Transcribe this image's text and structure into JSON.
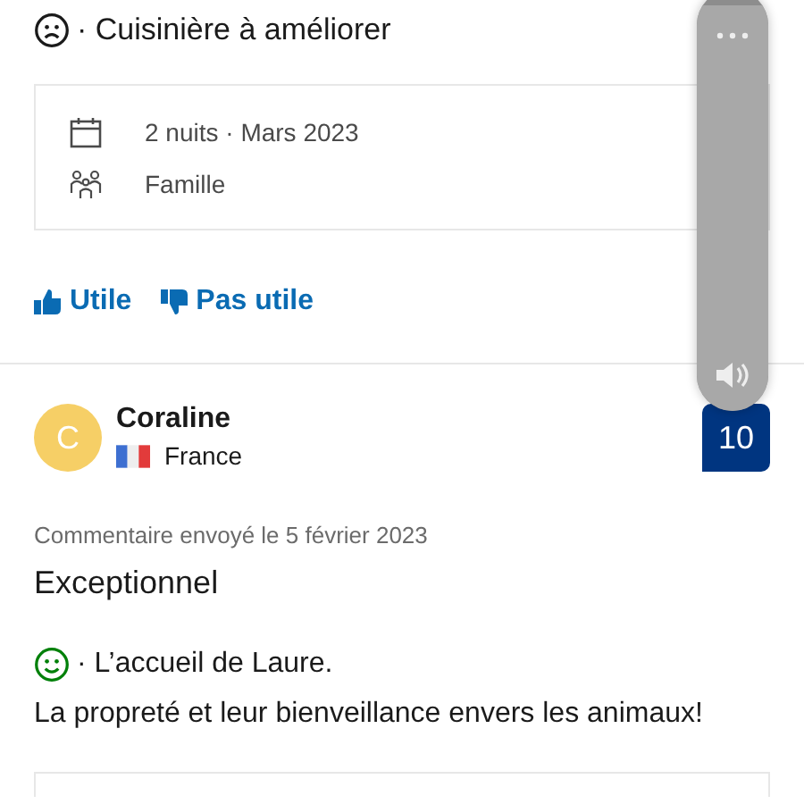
{
  "previous_review": {
    "negative": "· Cuisinière à améliorer",
    "stay": "2 nuits · Mars 2023",
    "traveler_type": "Famille",
    "buttons": [
      "Utile",
      "Pas utile"
    ]
  },
  "review": {
    "avatar": "C",
    "name": "Coraline",
    "country": "France",
    "score": "10",
    "date": "Commentaire envoyé le 5 février 2023",
    "title": "Exceptionnel",
    "positive": "· L’accueil de Laure.",
    "positive_more": "La propreté et leur bienveillance envers les animaux!"
  },
  "volume": {
    "level": 0.96
  }
}
